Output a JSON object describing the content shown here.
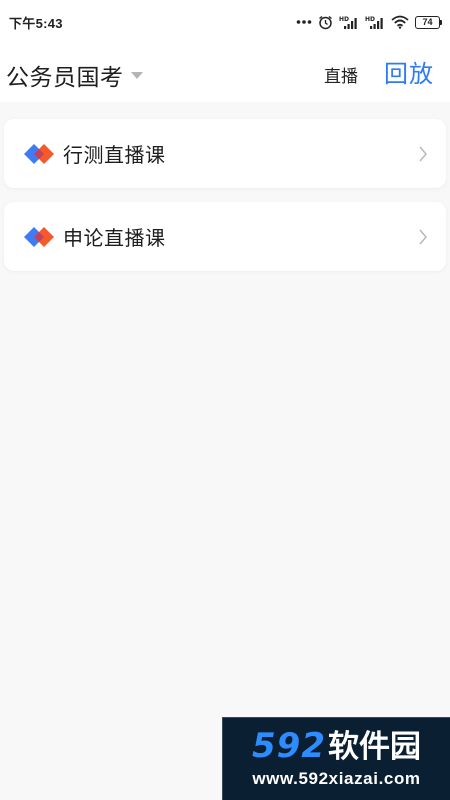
{
  "status_bar": {
    "time": "下午5:43",
    "battery": "74",
    "icons": [
      "more-dots-icon",
      "alarm-clock-icon",
      "hd-signal-icon",
      "hd-signal-icon",
      "wifi-icon",
      "battery-icon"
    ]
  },
  "header": {
    "exam_title": "公务员国考",
    "tab_live": "直播",
    "tab_replay": "回放",
    "accent_color": "#2e7cf2"
  },
  "courses": [
    {
      "label": "行测直播课",
      "icon": "diamond-logo-icon"
    },
    {
      "label": "申论直播课",
      "icon": "diamond-logo-icon"
    }
  ],
  "watermark": {
    "brand_num": "592",
    "brand_cn": "软件园",
    "url": "www.592xiazai.com"
  }
}
